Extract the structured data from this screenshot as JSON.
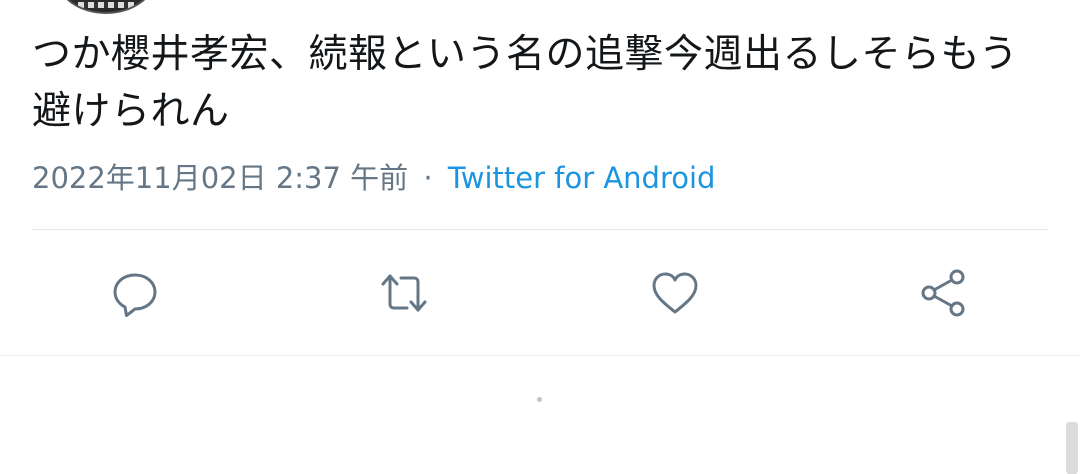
{
  "tweet": {
    "text": "つか櫻井孝宏、続報という名の追撃今週出るしそらもう避けられん",
    "timestamp": "2022年11月02日 2:37 午前",
    "separator": "·",
    "source": "Twitter for Android"
  },
  "actions": {
    "reply_icon": "reply-bubble-icon",
    "retweet_icon": "retweet-arrows-icon",
    "like_icon": "heart-outline-icon",
    "share_icon": "share-nodes-icon"
  },
  "colors": {
    "text": "#14171a",
    "secondary": "#657786",
    "link": "#1b95e0",
    "divider": "#e1e8ed"
  }
}
